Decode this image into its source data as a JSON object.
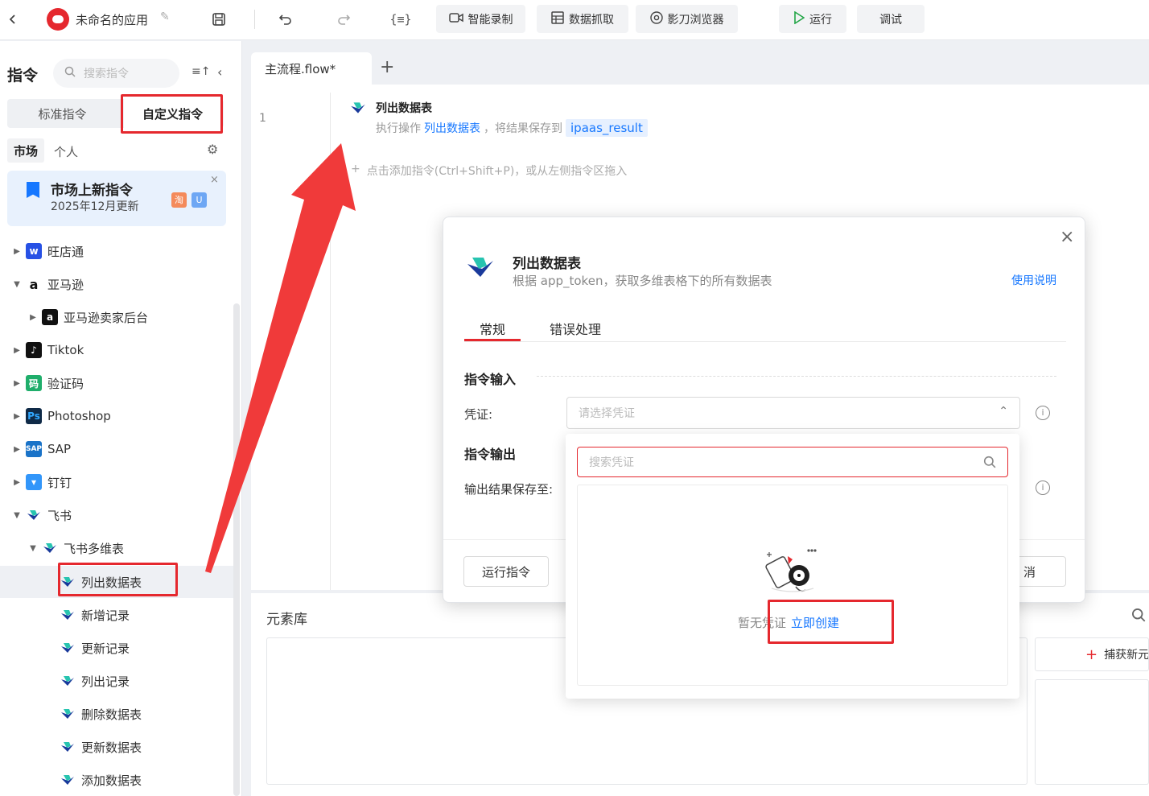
{
  "topbar": {
    "app_name": "未命名的应用",
    "btn_record": "智能录制",
    "btn_scrape": "数据抓取",
    "btn_browser": "影刀浏览器",
    "btn_run": "运行",
    "btn_debug": "调试"
  },
  "sidebar": {
    "title": "指令",
    "search_placeholder": "搜索指令",
    "tab_standard": "标准指令",
    "tab_custom": "自定义指令",
    "scope_market": "市场",
    "scope_personal": "个人",
    "promo_title": "市场上新指令",
    "promo_sub": "2025年12月更新",
    "tree": [
      {
        "label": "旺店通",
        "icon": "wangdiantong-icon"
      },
      {
        "label": "亚马逊",
        "icon": "amazon-icon"
      },
      {
        "label": "亚马逊卖家后台",
        "icon": "amazon-seller-icon"
      },
      {
        "label": "Tiktok",
        "icon": "tiktok-icon"
      },
      {
        "label": "验证码",
        "icon": "captcha-icon"
      },
      {
        "label": "Photoshop",
        "icon": "photoshop-icon"
      },
      {
        "label": "SAP",
        "icon": "sap-icon"
      },
      {
        "label": "钉钉",
        "icon": "dingtalk-icon"
      },
      {
        "label": "飞书",
        "icon": "feishu-icon"
      },
      {
        "label": "飞书多维表",
        "icon": "feishu-icon"
      },
      {
        "label": "列出数据表",
        "icon": "feishu-icon"
      },
      {
        "label": "新增记录",
        "icon": "feishu-icon"
      },
      {
        "label": "更新记录",
        "icon": "feishu-icon"
      },
      {
        "label": "列出记录",
        "icon": "feishu-icon"
      },
      {
        "label": "删除数据表",
        "icon": "feishu-icon"
      },
      {
        "label": "更新数据表",
        "icon": "feishu-icon"
      },
      {
        "label": "添加数据表",
        "icon": "feishu-icon"
      }
    ]
  },
  "editor": {
    "tab_label": "主流程.flow*",
    "line_number": "1",
    "step_title": "列出数据表",
    "step_desc_prefix": "执行操作",
    "step_desc_action": "列出数据表",
    "step_desc_mid": "，将结果保存到",
    "step_desc_var": "ipaas_result",
    "add_hint": "点击添加指令(Ctrl+Shift+P)，或从左侧指令区拖入"
  },
  "element_library": {
    "title": "元素库",
    "capture_button": "捕获新元"
  },
  "modal": {
    "title": "列出数据表",
    "subtitle": "根据 app_token，获取多维表格下的所有数据表",
    "help_link": "使用说明",
    "tab_general": "常规",
    "tab_error": "错误处理",
    "section_input": "指令输入",
    "credential_label": "凭证:",
    "credential_placeholder": "请选择凭证",
    "section_output": "指令输出",
    "output_label": "输出结果保存至:",
    "run_button": "运行指令",
    "cancel_button_partial": "消"
  },
  "dropdown": {
    "search_placeholder": "搜索凭证",
    "empty_text": "暂无凭证",
    "create_link": "立即创建"
  },
  "colors": {
    "accent": "#1677ff",
    "annotation_red": "#e5282e",
    "run_green": "#22a646"
  }
}
